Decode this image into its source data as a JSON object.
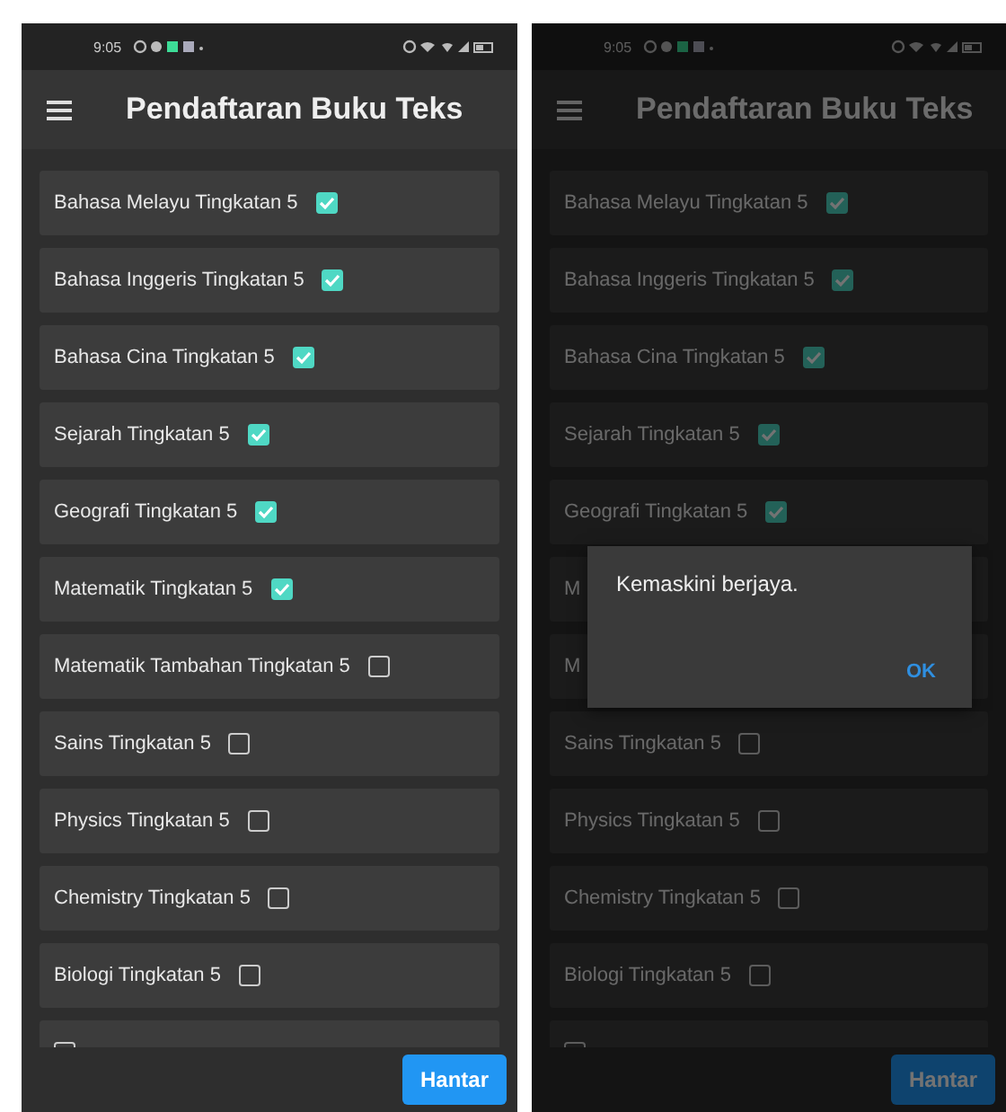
{
  "screens": [
    {
      "status_bar": {
        "time": "9:05"
      },
      "app_bar": {
        "title": "Pendaftaran Buku Teks"
      },
      "items": [
        {
          "label": "Bahasa Melayu Tingkatan 5",
          "checked": true
        },
        {
          "label": "Bahasa Inggeris Tingkatan 5",
          "checked": true
        },
        {
          "label": "Bahasa Cina Tingkatan 5",
          "checked": true
        },
        {
          "label": "Sejarah Tingkatan 5",
          "checked": true
        },
        {
          "label": "Geografi Tingkatan 5",
          "checked": true
        },
        {
          "label": "Matematik Tingkatan 5",
          "checked": true
        },
        {
          "label": "Matematik Tambahan Tingkatan 5",
          "checked": false
        },
        {
          "label": "Sains Tingkatan 5",
          "checked": false
        },
        {
          "label": "Physics Tingkatan 5",
          "checked": false
        },
        {
          "label": "Chemistry Tingkatan 5",
          "checked": false
        },
        {
          "label": "Biologi Tingkatan 5",
          "checked": false
        },
        {
          "checked": false
        }
      ],
      "submit_button": "Hantar"
    },
    {
      "status_bar": {
        "time": "9:05"
      },
      "app_bar": {
        "title": "Pendaftaran Buku Teks"
      },
      "items": [
        {
          "label": "Bahasa Melayu Tingkatan 5",
          "checked": true
        },
        {
          "label": "Bahasa Inggeris Tingkatan 5",
          "checked": true
        },
        {
          "label": "Bahasa Cina Tingkatan 5",
          "checked": true
        },
        {
          "label": "Sejarah Tingkatan 5",
          "checked": true
        },
        {
          "label": "Geografi Tingkatan 5",
          "checked": true
        },
        {
          "label": "M"
        },
        {
          "label": "M"
        },
        {
          "label": "Sains Tingkatan 5",
          "checked": false
        },
        {
          "label": "Physics Tingkatan 5",
          "checked": false
        },
        {
          "label": "Chemistry Tingkatan 5",
          "checked": false
        },
        {
          "label": "Biologi Tingkatan 5",
          "checked": false
        },
        {
          "checked": false
        }
      ],
      "submit_button": "Hantar",
      "dialog": {
        "message": "Kemaskini berjaya.",
        "button": "OK"
      }
    }
  ]
}
